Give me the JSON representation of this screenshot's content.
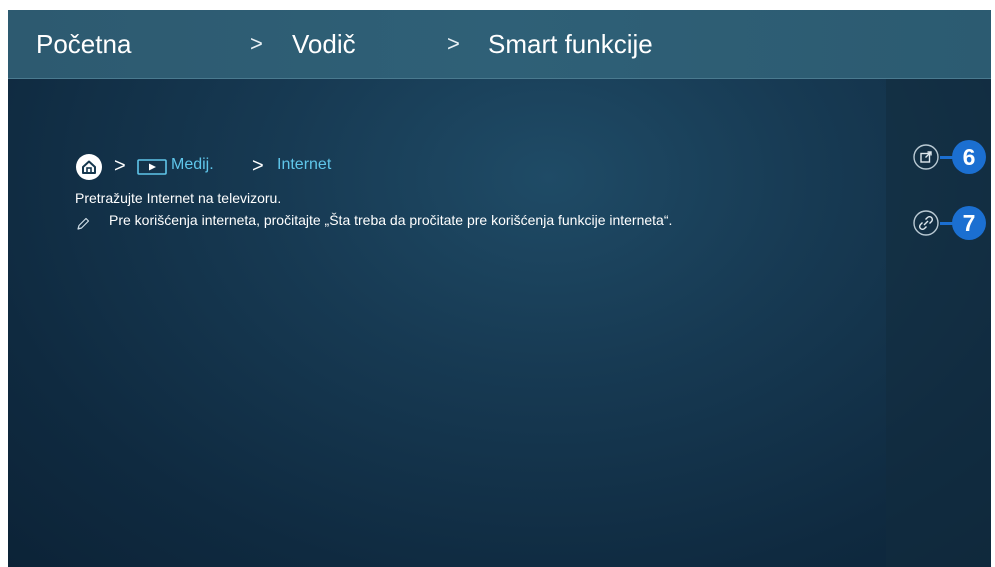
{
  "header": {
    "breadcrumb": [
      "Početna",
      "Vodič",
      "Smart funkcije"
    ],
    "separator": ">"
  },
  "path": {
    "separator": ">",
    "items": [
      {
        "icon": "home-icon"
      },
      {
        "icon": "media-icon",
        "label": "Medij."
      },
      {
        "label": "Internet"
      }
    ]
  },
  "content": {
    "description": "Pretražujte Internet na televizoru.",
    "note": "Pre korišćenja interneta, pročitajte „Šta treba da pročitate pre korišćenja funkcije interneta“."
  },
  "side_actions": [
    {
      "icon": "open-external-icon",
      "callout": "6"
    },
    {
      "icon": "link-icon",
      "callout": "7"
    }
  ],
  "colors": {
    "header_bg": "#2f6077",
    "content_bg": "#173a53",
    "link": "#5fc6ea",
    "callout": "#1b6fd1",
    "text": "#ffffff"
  }
}
